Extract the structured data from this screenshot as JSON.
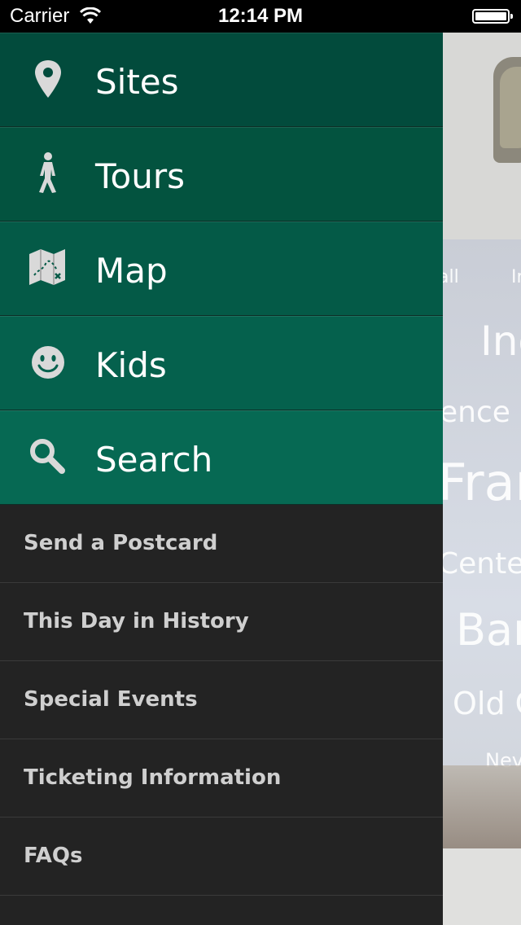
{
  "status_bar": {
    "carrier": "Carrier",
    "time": "12:14 PM"
  },
  "drawer": {
    "primary_items": [
      {
        "label": "Sites",
        "icon": "map-pin-icon",
        "color": "#024b3c"
      },
      {
        "label": "Tours",
        "icon": "walking-person-icon",
        "color": "#03533f"
      },
      {
        "label": "Map",
        "icon": "folded-map-icon",
        "color": "#045a47"
      },
      {
        "label": "Kids",
        "icon": "smiley-face-icon",
        "color": "#05614d"
      },
      {
        "label": "Search",
        "icon": "magnifier-icon",
        "color": "#066953"
      }
    ],
    "secondary_items": [
      {
        "label": "Send a Postcard"
      },
      {
        "label": "This Day in History"
      },
      {
        "label": "Special Events"
      },
      {
        "label": "Ticketing Information"
      },
      {
        "label": "FAQs"
      }
    ]
  },
  "background": {
    "word_cloud": [
      "all",
      "In",
      "Ind",
      "ence H",
      "Fran",
      "Center",
      "Ban",
      "Old C",
      "Nev"
    ]
  }
}
